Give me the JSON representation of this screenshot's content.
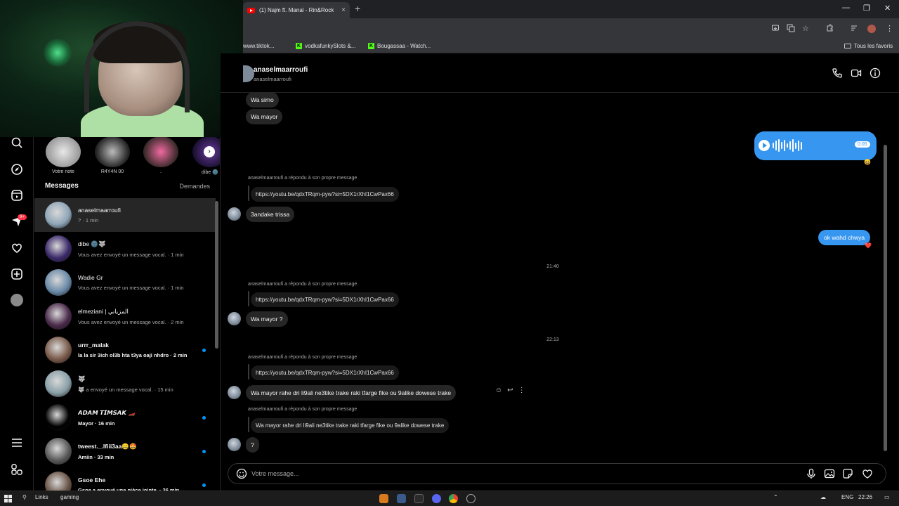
{
  "browser": {
    "tab_title": "(1) Najm ft. Manal - Rin&Rock",
    "tab_close": "×",
    "new_tab": "+",
    "window_controls": [
      "—",
      "❐",
      "✕"
    ],
    "bookmarks": [
      {
        "label": "www.tiktok...",
        "icon": "tiktok-icon"
      },
      {
        "label": "vodkafunkySlots &...",
        "icon": "kick-icon"
      },
      {
        "label": "Bougassaa - Watch...",
        "icon": "kick-icon"
      }
    ],
    "all_bookmarks": "Tous les favoris"
  },
  "inbox": {
    "notes": [
      {
        "label": "Votre note"
      },
      {
        "label": "R4Y4N 00"
      },
      {
        "label": "."
      },
      {
        "label": "dibe 🌚"
      }
    ],
    "title": "Messages",
    "requests": "Demandes",
    "conversations": [
      {
        "name": "anaselmaarroufi",
        "preview": "? · 1 min",
        "active": true,
        "unread": false,
        "color": "#8fa6b8"
      },
      {
        "name": "dibe 🌚🐺",
        "preview": "Vous avez envoyé un message vocal. · 1 min",
        "active": false,
        "unread": false,
        "color": "#3c2a6a"
      },
      {
        "name": "Wadie Gr",
        "preview": "Vous avez envoyé un message vocal. · 1 min",
        "active": false,
        "unread": false,
        "color": "#6a8aa8"
      },
      {
        "name": "elmeziani | المزياني",
        "preview": "Vous avez envoyé un message vocal. · 2 min",
        "active": false,
        "unread": false,
        "color": "#4a2a4a"
      },
      {
        "name": "urrr_malak",
        "preview": "la la sir 3ich ol3b hta t3ya oaji nhdro · 2 min",
        "active": false,
        "unread": true,
        "color": "#7a5a4a"
      },
      {
        "name": "🐺",
        "preview": "🐺 a envoyé un message vocal. · 15 min",
        "active": false,
        "unread": false,
        "color": "#8aa0a8"
      },
      {
        "name": "𝘼𝘿𝘼𝙈 𝙏𝙄𝙈𝙎𝘼𝙆 🏎️",
        "preview": "Mayor · 16 min",
        "active": false,
        "unread": true,
        "color": "#000000"
      },
      {
        "name": "tweest._.lfiii3aa🤐🤩",
        "preview": "Amiin · 33 min",
        "active": false,
        "unread": true,
        "color": "#5a5a5a"
      },
      {
        "name": "Gsoe Ehe",
        "preview": "Gsoe a envoyé une pièce jointe. · 36 min",
        "active": false,
        "unread": true,
        "color": "#6a5448"
      }
    ]
  },
  "chat": {
    "name": "anaselmaarroufi",
    "username": "anaselmaarroufi",
    "replied_label": "anaselmaarroufi a répondu à son propre message",
    "messages": {
      "m1": "Wa simo",
      "m2": "Wa mayor",
      "voice_duration": "0:05",
      "reply1_link": "https://youtu.be/qdxTRqm-pyw?si=5DX1rXhI1CwPax66",
      "m3": "3andake trissa",
      "out1": "ok wahd chwya",
      "time1": "21:40",
      "reply2_link": "https://youtu.be/qdxTRqm-pyw?si=5DX1rXhI1CwPax66",
      "m4": "Wa mayor ?",
      "time2": "22:13",
      "reply3_link": "https://youtu.be/qdxTRqm-pyw?si=5DX1rXhI1CwPax66",
      "m5": "Wa mayor rahe dri li9ali ne3tike trake raki tfarge fike ou 9alike dowese trake",
      "reply4_text": "Wa mayor rahe dri li9ali ne3tike trake raki tfarge fike ou 9alike dowese trake",
      "m6": "?"
    },
    "reactions": {
      "voice": "😄",
      "out1": "❤️"
    },
    "composer_placeholder": "Votre message..."
  },
  "taskbar": {
    "search_label": "Links",
    "app_label": "gaming",
    "lang": "ENG",
    "clock": "22:26"
  }
}
